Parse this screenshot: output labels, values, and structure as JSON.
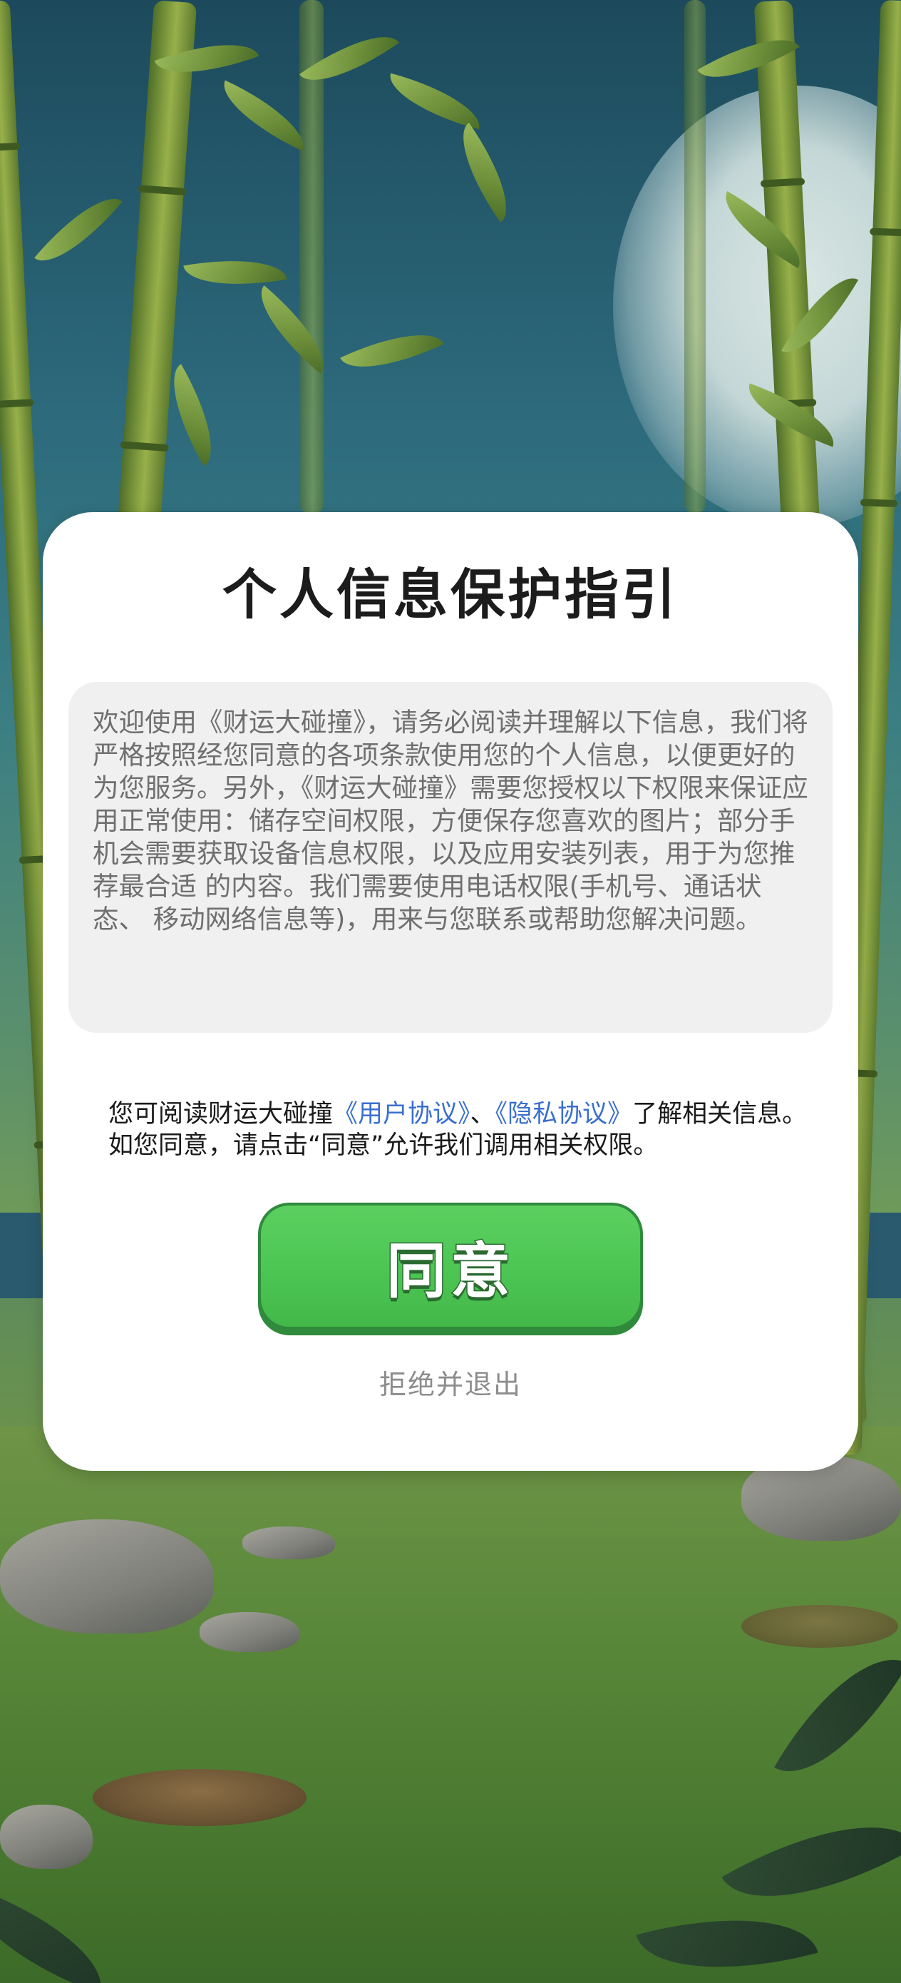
{
  "dialog": {
    "title": "个人信息保护指引",
    "body": "欢迎使用《财运大碰撞》，请务必阅读并理解以下信息，我们将严格按照经您同意的各项条款使用您的个人信息，以便更好的为您服务。另外，《财运大碰撞》需要您授权以下权限来保证应用正常使用：储存空间权限，方便保存您喜欢的图片；部分手机会需要获取设备信息权限，以及应用安装列表，用于为您推荐最合适 的内容。我们需要使用电话权限(手机号、通话状态、 移动网络信息等)，用来与您联系或帮助您解决问题。",
    "notice": {
      "prefix": "您可阅读财运大碰撞",
      "user_agreement": "《用户协议》",
      "separator": "、",
      "privacy_agreement": "《隐私协议》",
      "suffix": "了解相关信息。如您同意，请点击“同意”允许我们调用相关权限。"
    },
    "agree_label": "同意",
    "reject_label": "拒绝并退出"
  },
  "colors": {
    "link": "#3a6fd0",
    "agree_button": "#4cc553",
    "title": "#1c1c1c",
    "body_text": "#6f6f6f"
  }
}
